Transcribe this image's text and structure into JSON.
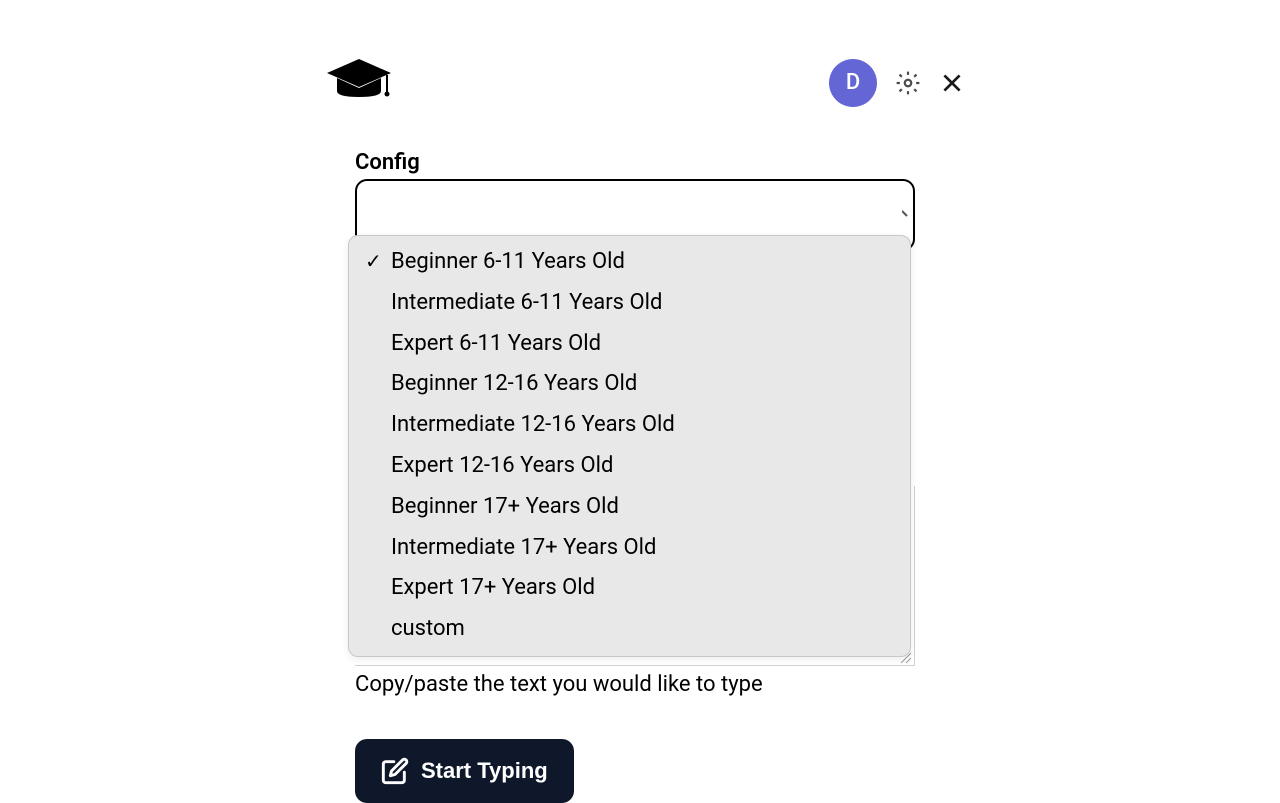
{
  "header": {
    "avatar_initial": "D"
  },
  "config": {
    "label": "Config",
    "selected_index": 0,
    "options": [
      "Beginner 6-11 Years Old",
      "Intermediate 6-11 Years Old",
      "Expert 6-11 Years Old",
      "Beginner 12-16 Years Old",
      "Intermediate 12-16 Years Old",
      "Expert 12-16 Years Old",
      "Beginner 17+ Years Old",
      "Intermediate 17+ Years Old",
      "Expert 17+ Years Old",
      "custom"
    ]
  },
  "textarea": {
    "helper": "Copy/paste the text you would like to type"
  },
  "button": {
    "start_label": "Start Typing"
  }
}
